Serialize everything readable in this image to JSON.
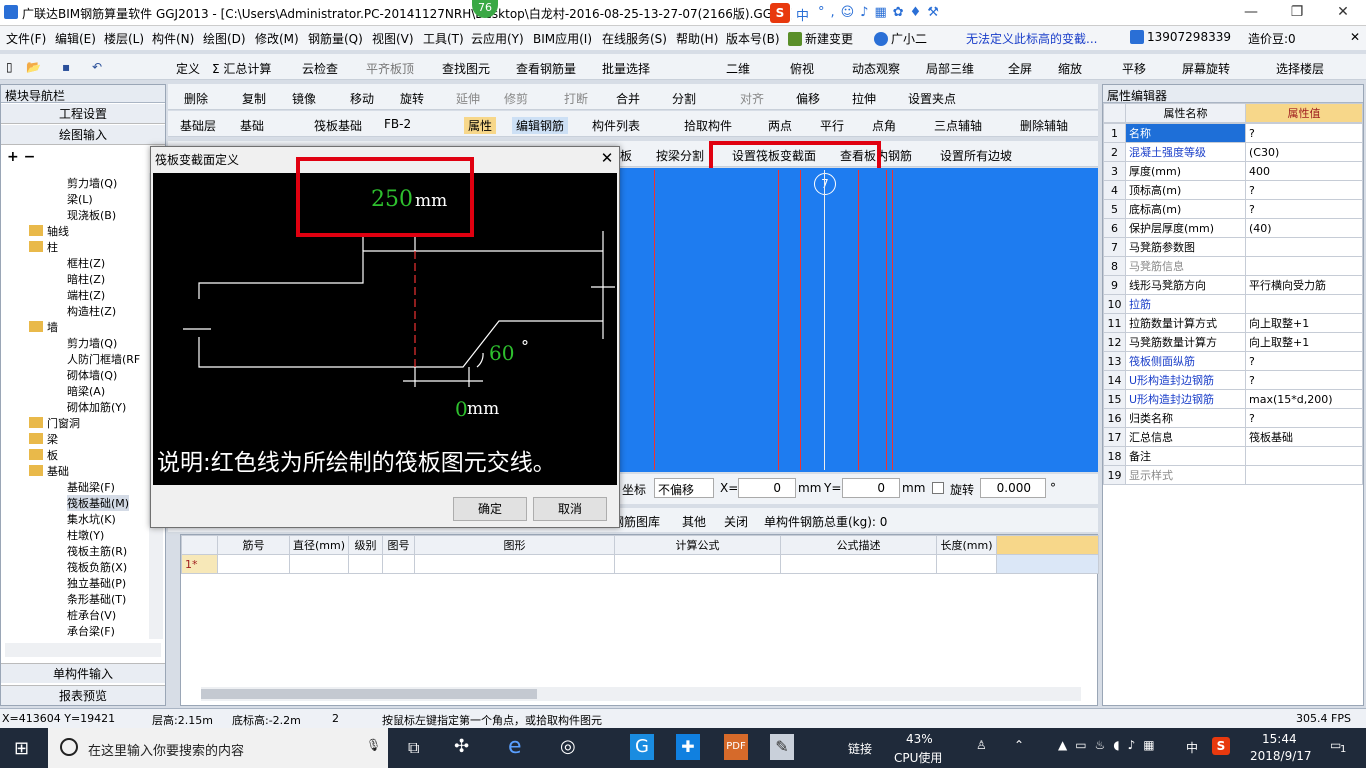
{
  "window": {
    "title": "广联达BIM钢筋算量软件 GGJ2013 - [C:\\Users\\Administrator.PC-20141127NRH\\Desktop\\白龙村-2016-08-25-13-27-07(2166版).GGJ12]",
    "badge": "76"
  },
  "ime": {
    "logo": "S",
    "lang": "中"
  },
  "menu": [
    "文件(F)",
    "编辑(E)",
    "楼层(L)",
    "构件(N)",
    "绘图(D)",
    "修改(M)",
    "钢筋量(Q)",
    "视图(V)",
    "工具(T)",
    "云应用(Y)",
    "BIM应用(I)",
    "在线服务(S)",
    "帮助(H)",
    "版本号(B)",
    "新建变更",
    "广小二",
    "无法定义此标高的变截...",
    "13907298339",
    "造价豆:0"
  ],
  "toolbar1": [
    "定义",
    "Σ 汇总计算",
    "云检查",
    "平齐板顶",
    "查找图元",
    "查看钢筋量",
    "批量选择",
    "二维",
    "俯视",
    "动态观察",
    "局部三维",
    "全屏",
    "缩放",
    "平移",
    "屏幕旋转",
    "选择楼层"
  ],
  "toolbar2": [
    "删除",
    "复制",
    "镜像",
    "移动",
    "旋转",
    "延伸",
    "修剪",
    "打断",
    "合并",
    "分割",
    "对齐",
    "偏移",
    "拉伸",
    "设置夹点"
  ],
  "toolbar3": [
    "基础层",
    "基础",
    "筏板基础",
    "FB-2",
    "属性",
    "编辑钢筋",
    "构件列表",
    "拾取构件",
    "两点",
    "平行",
    "点角",
    "三点辅轴",
    "删除辅轴"
  ],
  "toolbar4": [
    "板",
    "按梁分割",
    "设置筏板变截面",
    "查看板内钢筋",
    "设置所有边坡"
  ],
  "nav": {
    "title": "模块导航栏",
    "sections": [
      "工程设置",
      "绘图输入"
    ],
    "bottom": [
      "单构件输入",
      "报表预览"
    ],
    "tree": [
      {
        "label": "剪力墙(Q)",
        "level": 2
      },
      {
        "label": "梁(L)",
        "level": 2
      },
      {
        "label": "现浇板(B)",
        "level": 2
      },
      {
        "label": "轴线",
        "level": 1
      },
      {
        "label": "柱",
        "level": 1
      },
      {
        "label": "框柱(Z)",
        "level": 2
      },
      {
        "label": "暗柱(Z)",
        "level": 2
      },
      {
        "label": "端柱(Z)",
        "level": 2
      },
      {
        "label": "构造柱(Z)",
        "level": 2
      },
      {
        "label": "墙",
        "level": 1
      },
      {
        "label": "剪力墙(Q)",
        "level": 2
      },
      {
        "label": "人防门框墙(RF",
        "level": 2
      },
      {
        "label": "砌体墙(Q)",
        "level": 2
      },
      {
        "label": "暗梁(A)",
        "level": 2
      },
      {
        "label": "砌体加筋(Y)",
        "level": 2
      },
      {
        "label": "门窗洞",
        "level": 1
      },
      {
        "label": "梁",
        "level": 1
      },
      {
        "label": "板",
        "level": 1
      },
      {
        "label": "基础",
        "level": 1
      },
      {
        "label": "基础梁(F)",
        "level": 2
      },
      {
        "label": "筏板基础(M)",
        "level": 2
      },
      {
        "label": "集水坑(K)",
        "level": 2
      },
      {
        "label": "柱墩(Y)",
        "level": 2
      },
      {
        "label": "筏板主筋(R)",
        "level": 2
      },
      {
        "label": "筏板负筋(X)",
        "level": 2
      },
      {
        "label": "独立基础(P)",
        "level": 2
      },
      {
        "label": "条形基础(T)",
        "level": 2
      },
      {
        "label": "桩承台(V)",
        "level": 2
      },
      {
        "label": "承台梁(F)",
        "level": 2
      }
    ]
  },
  "dialog": {
    "title": "筏板变截面定义",
    "dim_top_value": "250",
    "dim_top_unit": "mm",
    "angle_value": "60",
    "angle_unit": "°",
    "dim_bottom_value": "0",
    "dim_bottom_unit": "mm",
    "note": "说明:红色线为所绘制的筏板图元交线。",
    "ok": "确定",
    "cancel": "取消"
  },
  "canvas": {
    "marker": "7"
  },
  "coordbar": {
    "label1": "坐标",
    "offset": "不偏移",
    "xlabel": "X=",
    "xval": "0",
    "unit1": "mm",
    "ylabel": "Y=",
    "yval": "0",
    "unit2": "mm",
    "rotate": "旋转",
    "rotval": "0.000",
    "deg": "°"
  },
  "rebarbar": [
    "钢筋图库",
    "其他",
    "关闭",
    "单构件钢筋总重(kg): 0"
  ],
  "rebar_table": {
    "headers": [
      "",
      "筋号",
      "直径(mm)",
      "级别",
      "图号",
      "图形",
      "计算公式",
      "公式描述",
      "长度(mm)"
    ],
    "rows": [
      [
        "1*",
        "",
        "",
        "",
        "",
        "",
        "",
        "",
        ""
      ]
    ]
  },
  "props": {
    "title": "属性编辑器",
    "col_name": "属性名称",
    "col_value": "属性值",
    "rows": [
      {
        "n": "1",
        "name": "名称",
        "value": "?",
        "style": "blue"
      },
      {
        "n": "2",
        "name": "混凝土强度等级",
        "value": "(C30)",
        "style": "blue"
      },
      {
        "n": "3",
        "name": "厚度(mm)",
        "value": "400",
        "style": ""
      },
      {
        "n": "4",
        "name": "顶标高(m)",
        "value": "?",
        "style": ""
      },
      {
        "n": "5",
        "name": "底标高(m)",
        "value": "?",
        "style": ""
      },
      {
        "n": "6",
        "name": "保护层厚度(mm)",
        "value": "(40)",
        "style": ""
      },
      {
        "n": "7",
        "name": "马凳筋参数图",
        "value": "",
        "style": ""
      },
      {
        "n": "8",
        "name": "马凳筋信息",
        "value": "",
        "style": "gray"
      },
      {
        "n": "9",
        "name": "线形马凳筋方向",
        "value": "平行横向受力筋",
        "style": ""
      },
      {
        "n": "10",
        "name": "拉筋",
        "value": "",
        "style": "blue"
      },
      {
        "n": "11",
        "name": "拉筋数量计算方式",
        "value": "向上取整+1",
        "style": ""
      },
      {
        "n": "12",
        "name": "马凳筋数量计算方",
        "value": "向上取整+1",
        "style": ""
      },
      {
        "n": "13",
        "name": "筏板侧面纵筋",
        "value": "?",
        "style": "blue"
      },
      {
        "n": "14",
        "name": "U形构造封边钢筋",
        "value": "?",
        "style": "blue"
      },
      {
        "n": "15",
        "name": "U形构造封边钢筋",
        "value": "max(15*d,200)",
        "style": "blue"
      },
      {
        "n": "16",
        "name": "归类名称",
        "value": "?",
        "style": ""
      },
      {
        "n": "17",
        "name": "汇总信息",
        "value": "筏板基础",
        "style": ""
      },
      {
        "n": "18",
        "name": "备注",
        "value": "",
        "style": ""
      },
      {
        "n": "19",
        "name": "显示样式",
        "value": "",
        "style": "gray"
      }
    ]
  },
  "status": {
    "coords": "X=413604 Y=19421",
    "floor_h": "层高:2.15m",
    "bottom_elev": "底标高:-2.2m",
    "num": "2",
    "hint": "按鼠标左键指定第一个角点，或拾取构件图元",
    "fps": "305.4 FPS"
  },
  "taskbar": {
    "search": "在这里输入你要搜索的内容",
    "link": "链接",
    "cpu": "43%",
    "cpu_label": "CPU使用",
    "ime": "中",
    "time": "15:44",
    "date": "2018/9/17",
    "notif": "1"
  }
}
